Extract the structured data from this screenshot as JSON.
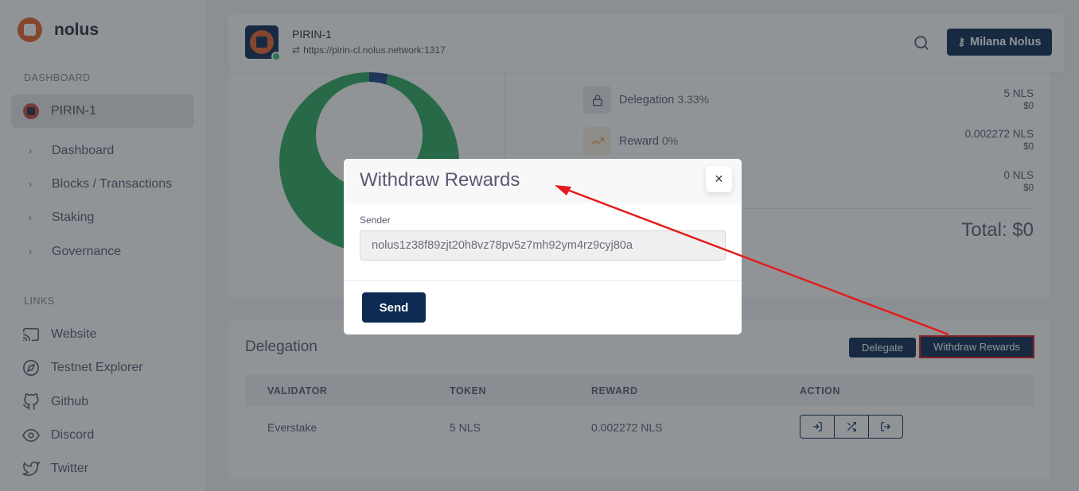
{
  "brand": {
    "name": "nolus"
  },
  "sidebar": {
    "dashboard_section": "DASHBOARD",
    "chain": "PIRIN-1",
    "nav": [
      {
        "label": "Dashboard"
      },
      {
        "label": "Blocks / Transactions"
      },
      {
        "label": "Staking"
      },
      {
        "label": "Governance"
      }
    ],
    "links_section": "LINKS",
    "links": [
      {
        "label": "Website",
        "icon": "cast-icon"
      },
      {
        "label": "Testnet Explorer",
        "icon": "compass-icon"
      },
      {
        "label": "Github",
        "icon": "github-icon"
      },
      {
        "label": "Discord",
        "icon": "eye-icon"
      },
      {
        "label": "Twitter",
        "icon": "twitter-icon"
      }
    ]
  },
  "header": {
    "chain": "PIRIN-1",
    "url": "https://pirin-cl.nolus.network:1317",
    "user_button": "Milana Nolus"
  },
  "stats": [
    {
      "label": "Delegation",
      "pct": "3.33%",
      "amount": "5 NLS",
      "usd": "$0"
    },
    {
      "label": "Reward",
      "pct": "0%",
      "amount": "0.002272 NLS",
      "usd": "$0"
    },
    {
      "label": "",
      "pct": "",
      "amount": "0 NLS",
      "usd": "$0"
    }
  ],
  "total": "Total: $0",
  "delegation": {
    "title": "Delegation",
    "delegate_button": "Delegate",
    "withdraw_button": "Withdraw Rewards",
    "columns": [
      "VALIDATOR",
      "TOKEN",
      "REWARD",
      "ACTION"
    ],
    "rows": [
      {
        "validator": "Everstake",
        "token": "5 NLS",
        "reward": "0.002272 NLS"
      }
    ]
  },
  "modal": {
    "title": "Withdraw Rewards",
    "close": "×",
    "sender_label": "Sender",
    "sender_value": "nolus1z38f89zjt20h8vz78pv5z7mh92ym4rz9cyj80a",
    "send_button": "Send"
  },
  "colors": {
    "primary": "#0d2a52",
    "brand_orange": "#e8622c",
    "donut_green": "#2eaa60",
    "donut_blue": "#213f83",
    "annotation_red": "#e41b1b"
  }
}
